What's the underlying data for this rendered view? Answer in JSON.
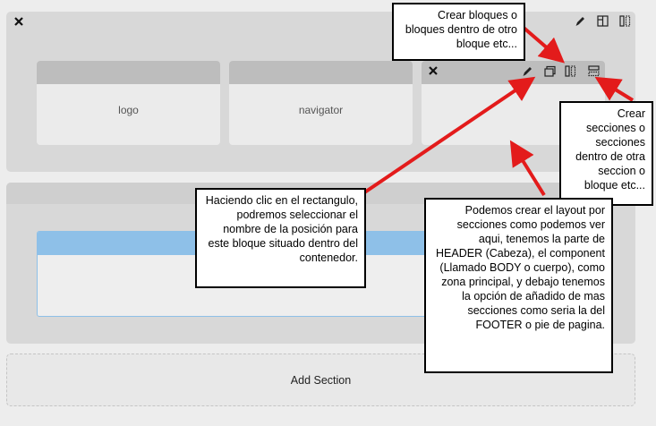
{
  "header_section": {
    "blocks": [
      {
        "label": "logo"
      },
      {
        "label": "navigator"
      },
      {
        "label": ""
      }
    ]
  },
  "body_section": {
    "component_color": "#8ec0e8"
  },
  "add_section": {
    "label": "Add Section"
  },
  "callouts": {
    "create_blocks": "Crear bloques o bloques dentro de otro bloque etc...",
    "create_sections": "Crear secciones o secciones dentro de otra seccion o bloque etc...",
    "select_position": "Haciendo clic en el rectangulo, podremos seleccionar  el nombre de la posición para este bloque situado dentro del contenedor.",
    "layout_info": "Podemos crear el layout por secciones como podemos ver aqui, tenemos la parte de HEADER (Cabeza), el component (Llamado BODY o cuerpo), como zona principal, y debajo tenemos la opción de añadido de mas secciones como seria la del FOOTER o pie de pagina."
  },
  "colors": {
    "arrow": "#e31b1b",
    "section_bg": "#d8d8d8",
    "block_bar": "#bdbdbd"
  },
  "icons": {
    "close": "close-icon",
    "edit": "pencil-icon",
    "add_block": "add-block-icon",
    "split_columns": "split-columns-icon",
    "add_section": "add-section-icon"
  }
}
